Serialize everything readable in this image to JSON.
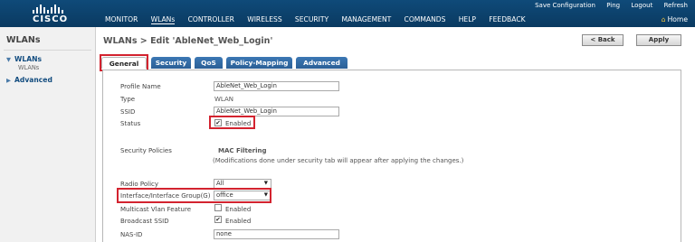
{
  "brand": {
    "logo_text": "CISCO"
  },
  "topnav": {
    "items": [
      "MONITOR",
      "WLANs",
      "CONTROLLER",
      "WIRELESS",
      "SECURITY",
      "MANAGEMENT",
      "COMMANDS",
      "HELP",
      "FEEDBACK"
    ],
    "active": "WLANs"
  },
  "toplinks": {
    "save": "Save Configuration",
    "ping": "Ping",
    "logout": "Logout",
    "refresh": "Refresh",
    "home": "Home"
  },
  "sidebar": {
    "title": "WLANs",
    "items": [
      {
        "label": "WLANs",
        "expanded": true,
        "sub": [
          "WLANs"
        ]
      },
      {
        "label": "Advanced",
        "expanded": false
      }
    ]
  },
  "page": {
    "title": "WLANs > Edit  'AbleNet_Web_Login'",
    "back_label": "< Back",
    "apply_label": "Apply"
  },
  "tabs": [
    "General",
    "Security",
    "QoS",
    "Policy-Mapping",
    "Advanced"
  ],
  "active_tab": "General",
  "form": {
    "profile_name": {
      "label": "Profile Name",
      "value": "AbleNet_Web_Login"
    },
    "type": {
      "label": "Type",
      "value": "WLAN"
    },
    "ssid": {
      "label": "SSID",
      "value": "AbleNet_Web_Login"
    },
    "status": {
      "label": "Status",
      "checked": true,
      "text": "Enabled"
    },
    "security_policies": {
      "label": "Security Policies",
      "value": "MAC Filtering",
      "note": "(Modifications done under security tab will appear after applying the changes.)"
    },
    "radio_policy": {
      "label": "Radio Policy",
      "value": "All"
    },
    "interface_group": {
      "label": "Interface/Interface Group(G)",
      "value": "office"
    },
    "multicast_vlan": {
      "label": "Multicast Vlan Feature",
      "checked": false,
      "text": "Enabled"
    },
    "broadcast_ssid": {
      "label": "Broadcast SSID",
      "checked": true,
      "text": "Enabled"
    },
    "nas_id": {
      "label": "NAS-ID",
      "value": "none"
    }
  },
  "colors": {
    "topbar": "#0f4a79",
    "tab": "#2b5f96",
    "highlight": "#d3232f",
    "sidebar": "#f1f1f1"
  }
}
